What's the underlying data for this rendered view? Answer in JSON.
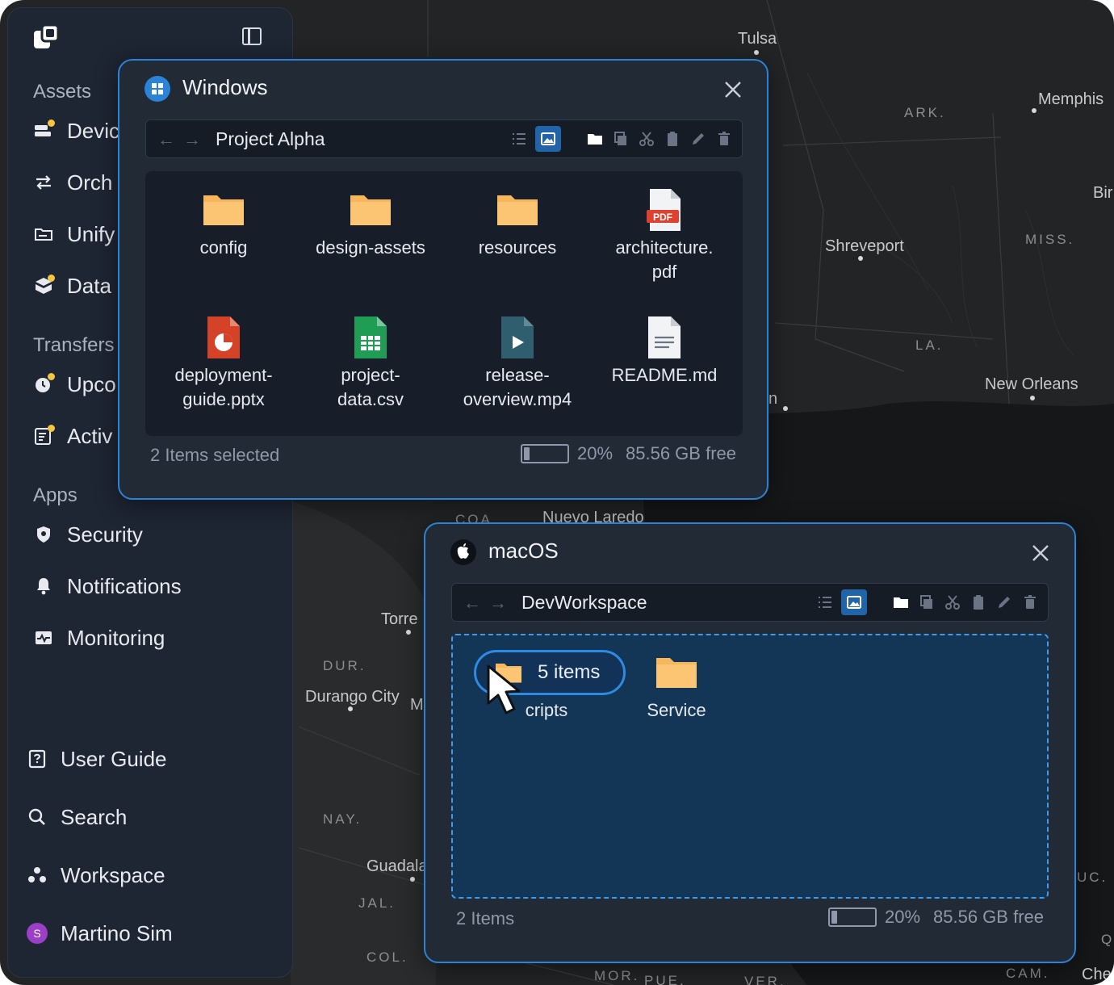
{
  "map": {
    "labels": [
      {
        "text": "Tulsa",
        "kind": "city"
      },
      {
        "text": "Memphis",
        "kind": "city"
      },
      {
        "text": "ARK.",
        "kind": "state"
      },
      {
        "text": "Bir",
        "kind": "city"
      },
      {
        "text": "MISS.",
        "kind": "state"
      },
      {
        "text": "Shreveport",
        "kind": "city"
      },
      {
        "text": "LA.",
        "kind": "state"
      },
      {
        "text": "New Orleans",
        "kind": "city"
      },
      {
        "text": "n",
        "kind": "city"
      },
      {
        "text": "COA.",
        "kind": "state"
      },
      {
        "text": "Nuevo Laredo",
        "kind": "city"
      },
      {
        "text": "Torre",
        "kind": "city"
      },
      {
        "text": "DUR.",
        "kind": "state"
      },
      {
        "text": "Durango City",
        "kind": "city"
      },
      {
        "text": "M",
        "kind": "city"
      },
      {
        "text": "NAY.",
        "kind": "state"
      },
      {
        "text": "Guadala",
        "kind": "city"
      },
      {
        "text": "JAL.",
        "kind": "state"
      },
      {
        "text": "COL.",
        "kind": "state"
      },
      {
        "text": "MOR.",
        "kind": "state"
      },
      {
        "text": "PUE.",
        "kind": "state"
      },
      {
        "text": "VER.",
        "kind": "state"
      },
      {
        "text": "CAM.",
        "kind": "state"
      },
      {
        "text": "UC.",
        "kind": "state"
      },
      {
        "text": "Q",
        "kind": "state"
      },
      {
        "text": "Che",
        "kind": "city"
      }
    ]
  },
  "sidebar": {
    "sections": {
      "assets": "Assets",
      "transfers": "Transfers",
      "apps": "Apps"
    },
    "items": [
      {
        "label": "Devic",
        "icon": "devices-icon"
      },
      {
        "label": "Orch",
        "icon": "orchestration-icon"
      },
      {
        "label": "Unify",
        "icon": "unify-icon"
      },
      {
        "label": "Data",
        "icon": "data-icon"
      },
      {
        "label": "Upco",
        "icon": "upcoming-icon"
      },
      {
        "label": "Activ",
        "icon": "activity-icon"
      },
      {
        "label": "Security",
        "icon": "shield-icon"
      },
      {
        "label": "Notifications",
        "icon": "bell-icon"
      },
      {
        "label": "Monitoring",
        "icon": "monitoring-icon"
      }
    ],
    "footer": [
      {
        "label": "User Guide",
        "icon": "help-book-icon"
      },
      {
        "label": "Search",
        "icon": "search-icon"
      },
      {
        "label": "Workspace",
        "icon": "workspace-icon"
      },
      {
        "label": "Martino Sim",
        "icon": "avatar",
        "initial": "S",
        "color": "#9b3fc7"
      }
    ]
  },
  "windows_explorer": {
    "title": "Windows",
    "path": "Project Alpha",
    "files": [
      {
        "name": "config",
        "type": "folder"
      },
      {
        "name": "design-assets",
        "type": "folder"
      },
      {
        "name": "resources",
        "type": "folder"
      },
      {
        "name": "architecture.\npdf",
        "type": "pdf"
      },
      {
        "name": "deployment-\nguide.pptx",
        "type": "pptx"
      },
      {
        "name": "project-\ndata.csv",
        "type": "csv"
      },
      {
        "name": "release-\noverview.mp4",
        "type": "video"
      },
      {
        "name": "README.md",
        "type": "doc"
      }
    ],
    "status": "2 Items selected",
    "storage_percent": "20%",
    "storage_fraction": 0.2,
    "free": "85.56 GB free"
  },
  "macos_explorer": {
    "title": "macOS",
    "path": "DevWorkspace",
    "files": [
      {
        "name": "cripts",
        "type": "folder"
      },
      {
        "name": "Service",
        "type": "folder"
      }
    ],
    "drag_label": "5 items",
    "status": "2 Items",
    "storage_percent": "20%",
    "storage_fraction": 0.2,
    "free": "85.56 GB free"
  },
  "colors": {
    "accent": "#2a83d6",
    "folder": "#f7b65c",
    "sidebar_bg": "#1e2533",
    "window_bg": "#222a36"
  }
}
